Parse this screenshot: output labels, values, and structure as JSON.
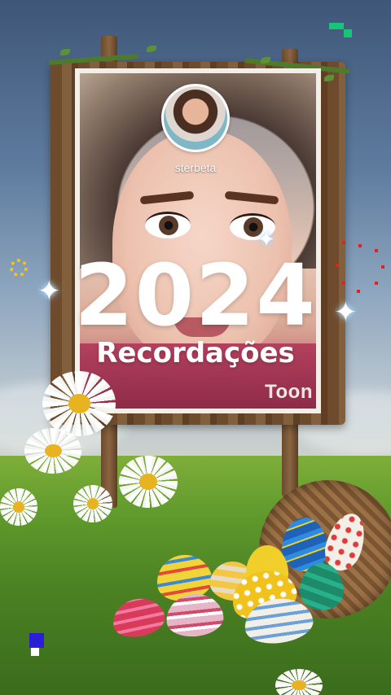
{
  "story": {
    "username": "sterbeta",
    "year": "2024",
    "subtitle": "Recordações",
    "watermark": "Toon"
  },
  "icons": {
    "sparkle": "✦"
  },
  "colors": {
    "sky_top": "#3e5678",
    "grass": "#5f9a2c",
    "text": "#ffffff",
    "accent_dots": "#e2231a",
    "ring_dots": "#f5c518"
  }
}
